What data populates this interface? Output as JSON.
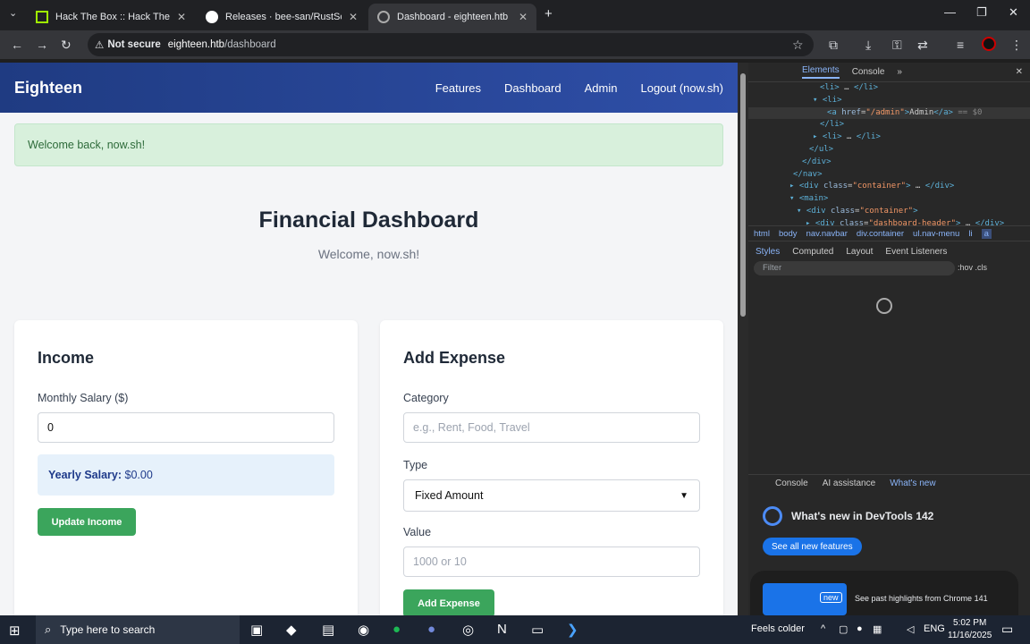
{
  "browser": {
    "tabs": [
      {
        "label": "Hack The Box :: Hack The Box",
        "active": false
      },
      {
        "label": "Releases · bee-san/RustScan",
        "active": false
      },
      {
        "label": "Dashboard - eighteen.htb",
        "active": true
      }
    ],
    "security_label": "Not secure",
    "url_host": "eighteen.htb",
    "url_path": "/dashboard"
  },
  "site": {
    "brand": "Eighteen",
    "nav": [
      "Features",
      "Dashboard",
      "Admin",
      "Logout (now.sh)"
    ],
    "alert": "Welcome back, now.sh!",
    "title": "Financial Dashboard",
    "subtitle": "Welcome, now.sh!"
  },
  "income": {
    "heading": "Income",
    "salary_label": "Monthly Salary ($)",
    "salary_value": "0",
    "yearly_label": "Yearly Salary:",
    "yearly_value": "$0.00",
    "button": "Update Income"
  },
  "expense": {
    "heading": "Add Expense",
    "category_label": "Category",
    "category_placeholder": "e.g., Rent, Food, Travel",
    "type_label": "Type",
    "type_value": "Fixed Amount",
    "value_label": "Value",
    "value_placeholder": "1000 or 10",
    "button": "Add Expense"
  },
  "devtools": {
    "tabs": [
      "Elements",
      "Console"
    ],
    "dom": {
      "admin_href": "/admin",
      "admin_text": "Admin",
      "eq": "== $0",
      "container_class": "container",
      "dash_header_class": "dashboard-header"
    },
    "breadcrumbs": [
      "html",
      "body",
      "nav.navbar",
      "div.container",
      "ul.nav-menu",
      "li",
      "a"
    ],
    "style_tabs": [
      "Styles",
      "Computed",
      "Layout",
      "Event Listeners"
    ],
    "filter_placeholder": "Filter",
    "hov_cls": ":hov .cls",
    "drawer_tabs": [
      "Console",
      "AI assistance",
      "What's new"
    ],
    "whats_new_title": "What's new in DevTools 142",
    "see_all": "See all new features",
    "new_badge": "new",
    "highlight_text": "See past highlights from Chrome 141"
  },
  "taskbar": {
    "search_placeholder": "Type here to search",
    "weather": "Feels colder",
    "lang": "ENG",
    "time": "5:02 PM",
    "date": "11/16/2025"
  },
  "colors": {
    "navbar": "#2f4fa8",
    "success_button": "#3ba55c",
    "alert_bg": "#d8f0dc",
    "yearly_bg": "#e6f1fb"
  }
}
